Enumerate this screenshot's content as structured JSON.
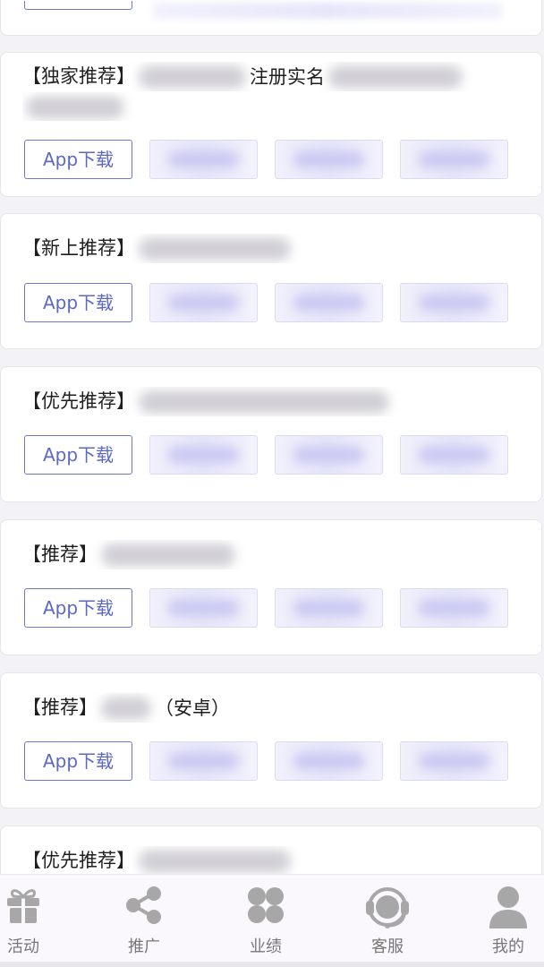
{
  "cards": [
    {
      "title_prefix": "【独家推荐】",
      "title_suffix": "注册实名",
      "download_label": "App下载",
      "status_text": ""
    },
    {
      "title_prefix": "【新上推荐】",
      "title_suffix": "",
      "download_label": "App下载",
      "status_text": ""
    },
    {
      "title_prefix": "【优先推荐】",
      "title_suffix": "",
      "download_label": "App下载",
      "status_text": ""
    },
    {
      "title_prefix": "【推荐】",
      "title_suffix": "",
      "download_label": "App下载",
      "status_text": ""
    },
    {
      "title_prefix": "【推荐】",
      "title_suffix": "（安卓）",
      "download_label": "App下载",
      "status_text": ""
    },
    {
      "title_prefix": "【优先推荐】",
      "title_suffix": "",
      "download_label": "",
      "status_text": ""
    }
  ],
  "tabbar": {
    "items": [
      {
        "label": "活动",
        "icon": "gift-icon"
      },
      {
        "label": "推广",
        "icon": "share-icon"
      },
      {
        "label": "业绩",
        "icon": "grid-icon"
      },
      {
        "label": "客服",
        "icon": "headset-icon"
      },
      {
        "label": "我的",
        "icon": "user-icon"
      }
    ]
  },
  "colors": {
    "accent": "#5c68c6",
    "tab_icon": "#a7a7a7",
    "tab_label": "#777777"
  }
}
